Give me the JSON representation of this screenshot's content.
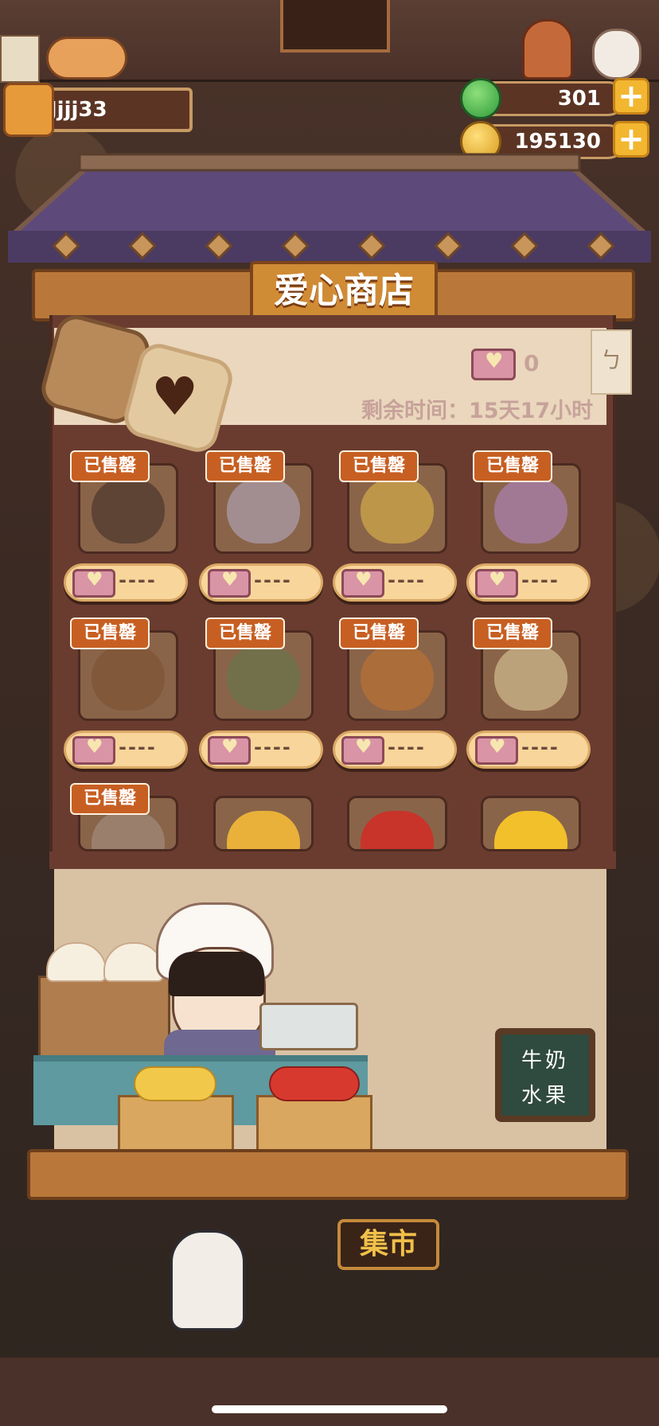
{
  "player": {
    "name": "Jjjj33"
  },
  "currencies": {
    "jade": "301",
    "coins": "195130"
  },
  "shop": {
    "title": "爱心商店",
    "ticket_count": "0",
    "remaining_time": "剩余时间：15天17小时",
    "side_tag": "ㄅ",
    "sold_label": "已售罄",
    "price_text": "----",
    "items": [
      {
        "sold": true,
        "has_price": true
      },
      {
        "sold": true,
        "has_price": true
      },
      {
        "sold": true,
        "has_price": true
      },
      {
        "sold": true,
        "has_price": true
      },
      {
        "sold": true,
        "has_price": true
      },
      {
        "sold": true,
        "has_price": true
      },
      {
        "sold": true,
        "has_price": true
      },
      {
        "sold": true,
        "has_price": true
      },
      {
        "sold": true,
        "has_price": false
      },
      {
        "sold": false,
        "has_price": false
      },
      {
        "sold": false,
        "has_price": false
      },
      {
        "sold": false,
        "has_price": false
      }
    ]
  },
  "chalkboard": {
    "line1": "牛奶",
    "line2": "水果"
  },
  "market_sign": "集市",
  "colors": {
    "sold_badge": "#c75f22",
    "price_pill": "#f8d59a",
    "panel": "#6a3c2f"
  }
}
